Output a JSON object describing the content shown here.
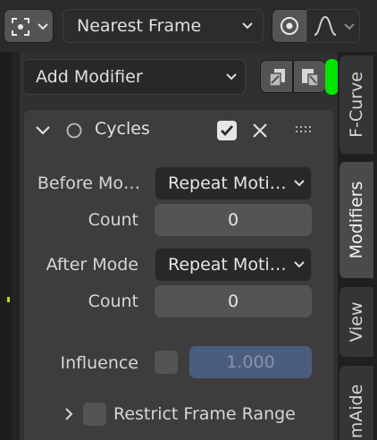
{
  "header": {
    "snap_mode": "Nearest Frame"
  },
  "toolbar": {
    "add_modifier": "Add Modifier"
  },
  "modifier": {
    "name": "Cycles",
    "enabled": true,
    "before_mode_label": "Before Mo…",
    "before_mode_value": "Repeat Moti…",
    "before_count_label": "Count",
    "before_count_value": "0",
    "after_mode_label": "After Mode",
    "after_mode_value": "Repeat Moti…",
    "after_count_label": "Count",
    "after_count_value": "0",
    "influence_label": "Influence",
    "influence_value": "1.000",
    "restrict_label": "Restrict Frame Range"
  },
  "tabs": [
    {
      "label": "F-Curve",
      "active": false
    },
    {
      "label": "Modifiers",
      "active": true
    },
    {
      "label": "View",
      "active": false
    },
    {
      "label": "mAide",
      "active": false
    }
  ],
  "colors": {
    "accent_green": "#00e400",
    "influence_field": "#4b5d7e"
  }
}
